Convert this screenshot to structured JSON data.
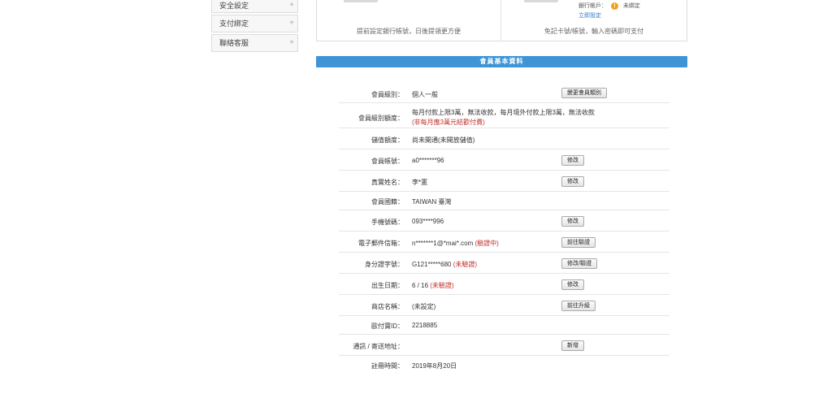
{
  "sidebar": {
    "items": [
      {
        "label": "安全設定"
      },
      {
        "label": "支付綁定"
      },
      {
        "label": "聯絡客服"
      }
    ],
    "expand_glyph": "+"
  },
  "top_panel": {
    "left_hint": "提前設定銀行帳號，日後提領更方便",
    "right_hint": "免記卡號/帳號，輸入密碼即可支付",
    "bank_label": "銀行帳戶：",
    "bank_warn_glyph": "!",
    "bank_status": "未綁定",
    "bank_link": "立即設定"
  },
  "section": {
    "title": "會員基本資料"
  },
  "rows": [
    {
      "label": "會員級別：",
      "value": "個人一般",
      "button": "變更會員類別"
    },
    {
      "label": "會員級別額度：",
      "value": "每月付款上限3萬，無法收款，每月境外付款上限3萬，無法收款",
      "value2": "(非每月應3萬元結歡付費)"
    },
    {
      "label": "儲值額度：",
      "value": "尚未開通(未開放儲值)"
    },
    {
      "label": "會員帳號：",
      "value": "a0*******96",
      "button": "修改"
    },
    {
      "label": "真實姓名：",
      "value": "李*憲",
      "button": "修改"
    },
    {
      "label": "會員國籍：",
      "value": "TAIWAN 臺灣"
    },
    {
      "label": "手機號碼：",
      "value": "093****996",
      "button": "修改"
    },
    {
      "label": "電子郵件信箱：",
      "value": "n*******1@*mai*.com",
      "status": "(驗證中)",
      "button": "前往驗證"
    },
    {
      "label": "身分證字號：",
      "value": "G121*****680",
      "status": "(未驗證)",
      "button": "修改/驗證"
    },
    {
      "label": "出生日期：",
      "value": "6 / 16",
      "status": "(未驗證)",
      "button": "修改"
    },
    {
      "label": "商店名稱：",
      "status": "(未設定)",
      "button": "前往升級"
    },
    {
      "label": "歐付寶ID：",
      "value": "2218885"
    },
    {
      "label": "通訊 / 寄送地址：",
      "button": "新增"
    },
    {
      "label": "註冊時間：",
      "value": "2019年8月20日"
    }
  ]
}
